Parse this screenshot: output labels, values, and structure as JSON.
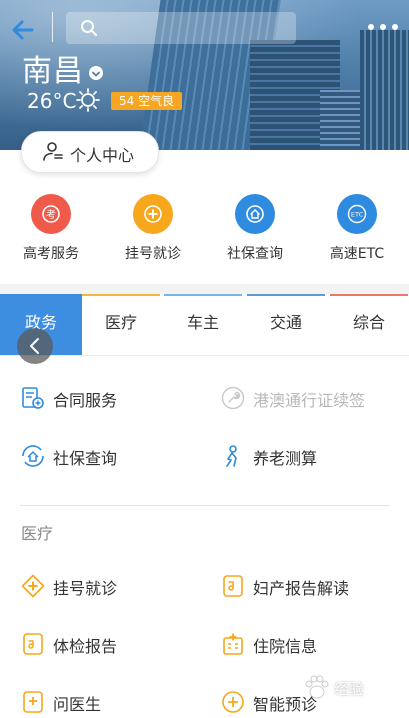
{
  "header": {
    "city": "南昌",
    "temperature": "26°C",
    "aqi": "54 空气良",
    "icons": [
      "back-arrow-icon",
      "search-icon",
      "more-dots-icon",
      "chevron-down-icon",
      "sun-icon"
    ]
  },
  "profile": {
    "label": "个人中心"
  },
  "quick_services": [
    {
      "label": "高考服务",
      "color": "#f05a4a",
      "icon": "exam-icon"
    },
    {
      "label": "挂号就诊",
      "color": "#f7a71b",
      "icon": "medical-cross-icon"
    },
    {
      "label": "社保查询",
      "color": "#2f8be0",
      "icon": "social-security-icon"
    },
    {
      "label": "高速ETC",
      "color": "#2f8be0",
      "icon": "etc-icon"
    }
  ],
  "tabs": [
    {
      "label": "政务",
      "color": "#3d8ee0",
      "active": true
    },
    {
      "label": "医疗",
      "color": "#f6b73c",
      "active": false
    },
    {
      "label": "车主",
      "color": "#7ab4e3",
      "active": false
    },
    {
      "label": "交通",
      "color": "#5c9bd6",
      "active": false
    },
    {
      "label": "综合",
      "color": "#e8766a",
      "active": false
    }
  ],
  "government": {
    "items": [
      {
        "label": "合同服务",
        "icon": "contract-icon",
        "disabled": false
      },
      {
        "label": "港澳通行证续签",
        "icon": "wrench-icon",
        "disabled": true
      },
      {
        "label": "社保查询",
        "icon": "social-security-icon",
        "disabled": false
      },
      {
        "label": "养老测算",
        "icon": "pension-icon",
        "disabled": false
      }
    ]
  },
  "medical": {
    "title": "医疗",
    "items": [
      {
        "label": "挂号就诊",
        "icon": "medical-cross-icon"
      },
      {
        "label": "妇产报告解读",
        "icon": "report-icon"
      },
      {
        "label": "体检报告",
        "icon": "checkup-icon"
      },
      {
        "label": "住院信息",
        "icon": "hospital-icon"
      },
      {
        "label": "问医生",
        "icon": "ask-doctor-icon"
      },
      {
        "label": "智能预诊",
        "icon": "smart-diagnosis-icon"
      }
    ]
  },
  "watermark": {
    "text": "经验"
  },
  "colors": {
    "accent": "#3d8ee0",
    "orange": "#f7a71b",
    "blue": "#2f8be0",
    "red": "#f05a4a"
  }
}
